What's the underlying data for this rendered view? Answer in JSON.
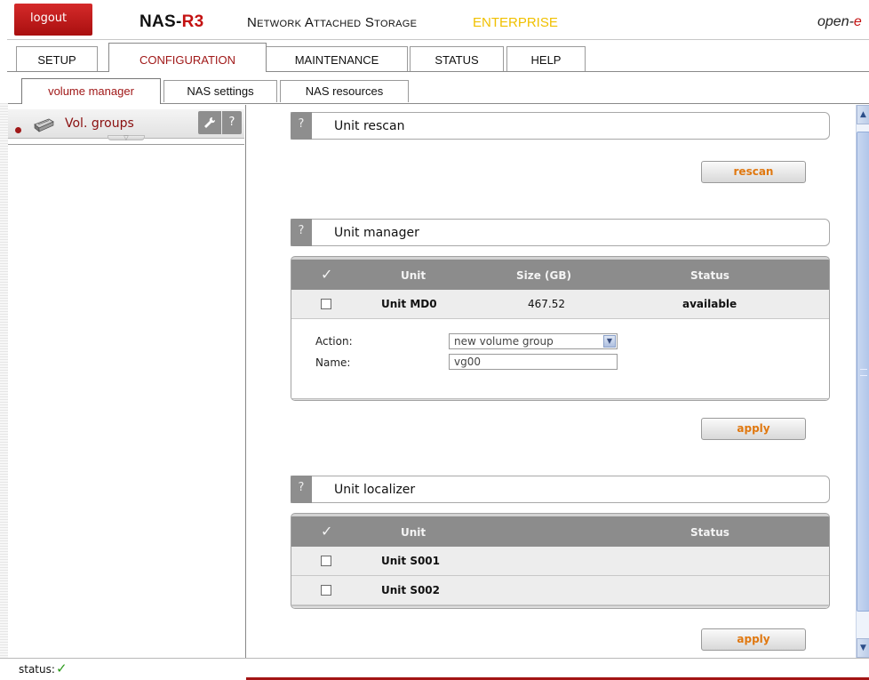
{
  "header": {
    "logout_label": "logout",
    "logo_main": "NAS-",
    "logo_accent": "R3",
    "subtitle": "Network Attached Storage",
    "edition": "ENTERPRISE",
    "brand_main": "open-",
    "brand_accent": "e"
  },
  "main_tabs": [
    {
      "label": "SETUP"
    },
    {
      "label": "CONFIGURATION"
    },
    {
      "label": "MAINTENANCE"
    },
    {
      "label": "STATUS"
    },
    {
      "label": "HELP"
    }
  ],
  "sub_tabs": [
    {
      "label": "volume manager"
    },
    {
      "label": "NAS settings"
    },
    {
      "label": "NAS resources"
    }
  ],
  "sidebar": {
    "item_label": "Vol. groups",
    "help_glyph": "?",
    "icons": {
      "item": "disk-drive-icon",
      "config": "wrench-icon",
      "help": "help-icon",
      "expand": "expand-arrow-icon"
    }
  },
  "unit_rescan": {
    "help_glyph": "?",
    "title": "Unit rescan",
    "button_label": "rescan"
  },
  "unit_manager": {
    "help_glyph": "?",
    "title": "Unit manager",
    "columns": {
      "check": "✓",
      "unit": "Unit",
      "size": "Size (GB)",
      "status": "Status"
    },
    "rows": [
      {
        "unit": "Unit MD0",
        "size": "467.52",
        "status": "available",
        "checked": false
      }
    ],
    "action_label": "Action:",
    "action_value": "new volume group",
    "name_label": "Name:",
    "name_value": "vg00",
    "apply_label": "apply"
  },
  "unit_localizer": {
    "help_glyph": "?",
    "title": "Unit localizer",
    "columns": {
      "check": "✓",
      "unit": "Unit",
      "status": "Status"
    },
    "rows": [
      {
        "unit": "Unit S001",
        "status": "",
        "checked": false
      },
      {
        "unit": "Unit S002",
        "status": "",
        "checked": false
      }
    ],
    "apply_label": "apply"
  },
  "statusbar": {
    "label": "status:",
    "state_icon": "checkmark-icon",
    "state_color": "#2a9a1a"
  },
  "colors": {
    "accent_red": "#a01818",
    "button_text": "#e07810",
    "table_header": "#8c8c8c"
  }
}
